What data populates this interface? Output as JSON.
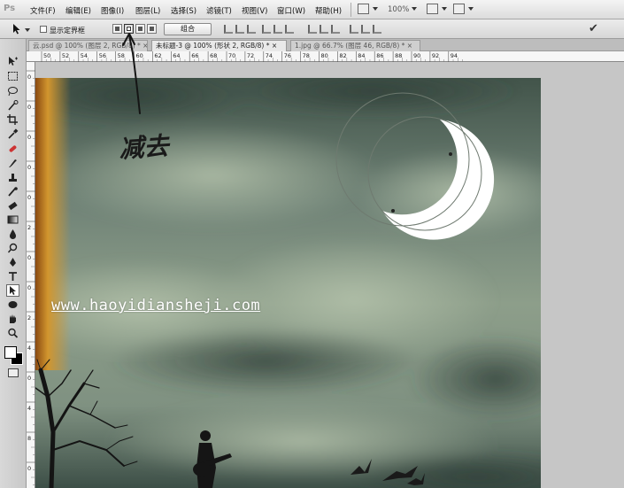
{
  "app": {
    "logo": "Ps"
  },
  "menu": {
    "items": [
      "文件(F)",
      "编辑(E)",
      "图像(I)",
      "图层(L)",
      "选择(S)",
      "滤镜(T)",
      "视图(V)",
      "窗口(W)",
      "帮助(H)"
    ],
    "zoom": "100%"
  },
  "options": {
    "show_bounding_box_label": "显示定界框",
    "combine_label": "组合"
  },
  "tabs": [
    {
      "label": "云.psd @ 100% (图层 2, RGB/8) * ×",
      "active": false
    },
    {
      "label": "未标题-3 @ 100% (形状 2, RGB/8) * ×",
      "active": true
    },
    {
      "label": "1.jpg @ 66.7% (图层 46, RGB/8) * ×",
      "active": false
    }
  ],
  "ruler": {
    "top": [
      "50",
      "52",
      "54",
      "56",
      "58",
      "60",
      "62",
      "64",
      "66",
      "68",
      "70",
      "72",
      "74",
      "76",
      "78",
      "80",
      "82",
      "84",
      "86",
      "88",
      "90",
      "92",
      "94"
    ],
    "left": [
      "0",
      "0",
      "0",
      "0",
      "0",
      "2",
      "0",
      "0",
      "2",
      "4",
      "0",
      "4",
      "8",
      "0"
    ]
  },
  "annotation": {
    "handwritten_note": "减去"
  },
  "watermark": "www.haoyidiansheji.com",
  "colors": {
    "sky_dark": "#3f5148",
    "sky_light": "#9aab94",
    "moon": "#ffffff",
    "selection_circle": "#6f7a70",
    "orange_edge": "#c98a2a"
  }
}
